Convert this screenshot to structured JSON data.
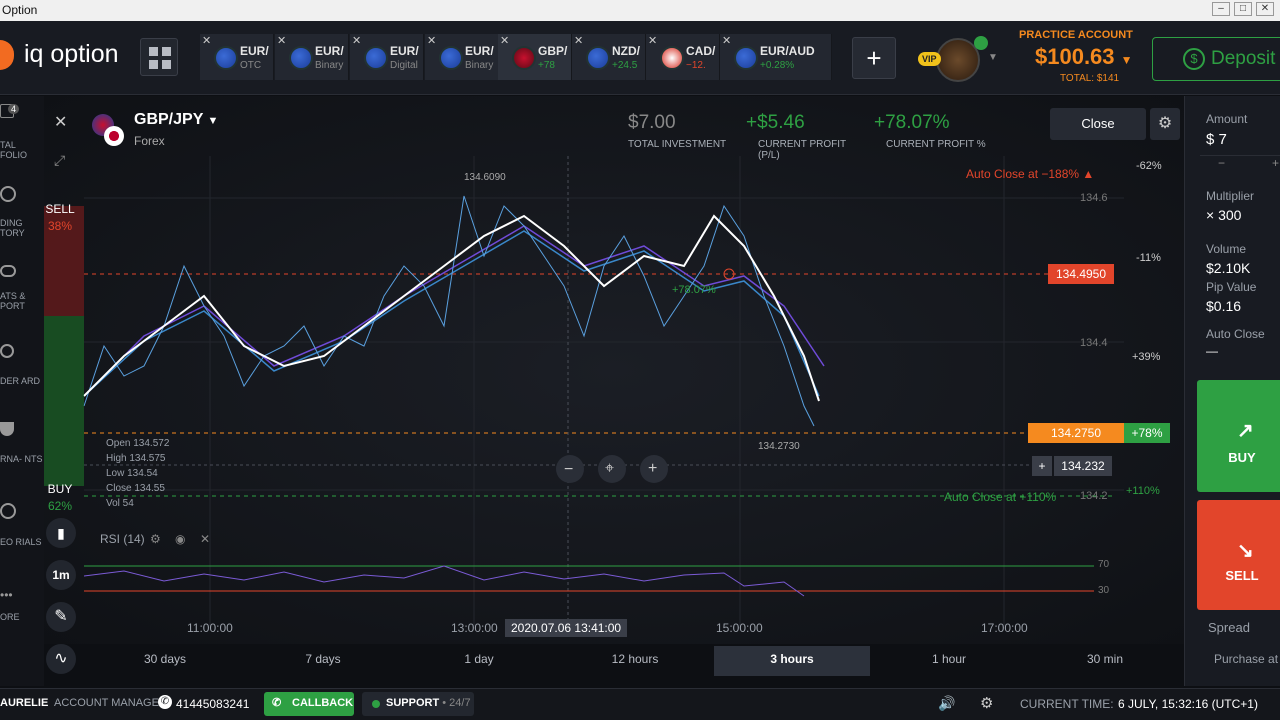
{
  "window": {
    "title": "Option"
  },
  "logo": {
    "text": "iq option"
  },
  "tabs": [
    {
      "name": "EUR/",
      "sub": "OTC"
    },
    {
      "name": "EUR/",
      "sub": "Binary"
    },
    {
      "name": "EUR/",
      "sub": "Digital"
    },
    {
      "name": "EUR/",
      "sub": "Binary"
    },
    {
      "name": "GBP/",
      "sub": "+78"
    },
    {
      "name": "NZD/",
      "sub": "+24.5"
    },
    {
      "name": "CAD/",
      "sub": "−12."
    },
    {
      "name": "EUR/AUD",
      "sub": "+0.28%"
    }
  ],
  "account": {
    "label": "PRACTICE ACCOUNT",
    "balance": "$100.63",
    "total": "TOTAL: $141",
    "vip": "VIP"
  },
  "deposit": {
    "label": "Deposit"
  },
  "left_nav": [
    {
      "label": "TAL FOLIO",
      "badge": "4"
    },
    {
      "label": "DING TORY"
    },
    {
      "label": "ATS & PORT"
    },
    {
      "label": "DER ARD"
    },
    {
      "label": "RNA- NTS"
    },
    {
      "label": "EO RIALS"
    },
    {
      "label": "ORE"
    }
  ],
  "asset": {
    "name": "GBP/JPY",
    "type": "Forex"
  },
  "trade_stats": {
    "investment": "$7.00",
    "investment_label": "TOTAL INVESTMENT",
    "profit": "+$5.46",
    "profit_label": "CURRENT PROFIT (P/L)",
    "profit_pct": "+78.07%",
    "profit_pct_label": "CURRENT PROFIT %"
  },
  "close_button": "Close",
  "sentiment": {
    "sell_label": "SELL",
    "sell_pct": "38%",
    "buy_label": "BUY",
    "buy_pct": "62%"
  },
  "chart_labels": {
    "peak_label": "134.6090",
    "trade_pct": "+78.07%",
    "low_label": "134.2730",
    "auto_close_top": "Auto Close at −188% ▲",
    "auto_close_bottom": "Auto Close at +110%",
    "entry_price": "134.4950",
    "current_price": "134.2750",
    "current_pct": "+78%",
    "crosshair_price": "134.232",
    "right_pcts": [
      "-62%",
      "-11%",
      "+39%",
      "+110%"
    ],
    "y_ticks": [
      "134.6",
      "134.4",
      "134.2"
    ],
    "ohlc": [
      "Open 134.572",
      "High 134.575",
      "Low 134.54",
      "Close 134.55",
      "Vol 54"
    ],
    "rsi_label": "RSI (14)",
    "rsi_levels": [
      "70",
      "30"
    ],
    "time_ticks": [
      "11:00:00",
      "13:00:00",
      "15:00:00",
      "17:00:00"
    ],
    "crosshair_time": "2020.07.06 13:41:00",
    "interval": "1m"
  },
  "timeframes": [
    "30 days",
    "7 days",
    "1 day",
    "12 hours",
    "3 hours",
    "1 hour",
    "30 min"
  ],
  "selected_timeframe": "3 hours",
  "right_panel": {
    "amount_label": "Amount",
    "amount": "$ 7",
    "multiplier_label": "Multiplier",
    "multiplier": "× 300",
    "volume_label": "Volume",
    "volume": "$2.10K",
    "pip_label": "Pip Value",
    "pip": "$0.16",
    "autoclose_label": "Auto Close",
    "autoclose": "—",
    "buy": "BUY",
    "sell": "SELL",
    "spread": "Spread",
    "purchase": "Purchase at"
  },
  "bottom": {
    "user": "AURELIE",
    "manager": "ACCOUNT MANAGER",
    "phone": "41445083241",
    "callback": "CALLBACK",
    "support": "SUPPORT",
    "support_hours": "• 24/7",
    "time_label": "CURRENT TIME:",
    "time": "6 JULY, 15:32:16 (UTC+1)"
  },
  "colors": {
    "accent": "#f58a1f",
    "buy": "#2ea043",
    "sell": "#e2452b"
  }
}
